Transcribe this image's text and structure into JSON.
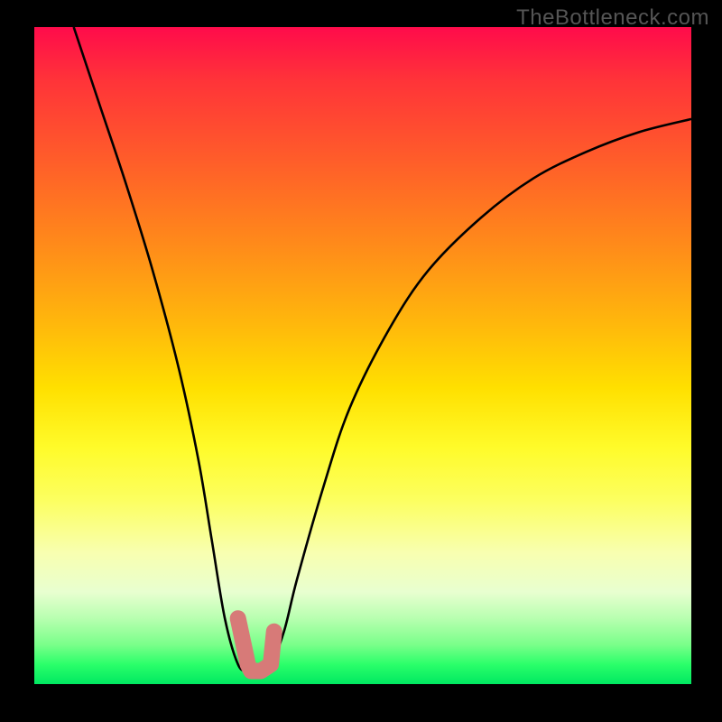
{
  "watermark": "TheBottleneck.com",
  "chart_data": {
    "type": "line",
    "title": "",
    "xlabel": "",
    "ylabel": "",
    "xlim": [
      0,
      100
    ],
    "ylim": [
      0,
      100
    ],
    "x": [
      6,
      10,
      14,
      18,
      22,
      25,
      27,
      29,
      31,
      32.5,
      34,
      36,
      38,
      40,
      44,
      48,
      54,
      60,
      68,
      76,
      84,
      92,
      100
    ],
    "values": [
      100,
      88,
      76,
      63,
      48,
      34,
      22,
      10,
      3,
      2,
      2,
      3,
      8,
      16,
      30,
      42,
      54,
      63,
      71,
      77,
      81,
      84,
      86
    ],
    "marker": {
      "color": "#d77a78",
      "points_x": [
        31,
        32.5,
        33,
        34,
        34.5,
        36,
        36.5
      ],
      "points_y": [
        10,
        3,
        2,
        2,
        2,
        3,
        8
      ]
    },
    "gradient_stops": [
      {
        "pos": 0,
        "color": "#ff0b4b"
      },
      {
        "pos": 20,
        "color": "#ff5c2a"
      },
      {
        "pos": 45,
        "color": "#ffb70c"
      },
      {
        "pos": 64,
        "color": "#fffb2a"
      },
      {
        "pos": 86,
        "color": "#e8ffd0"
      },
      {
        "pos": 100,
        "color": "#00e861"
      }
    ]
  }
}
